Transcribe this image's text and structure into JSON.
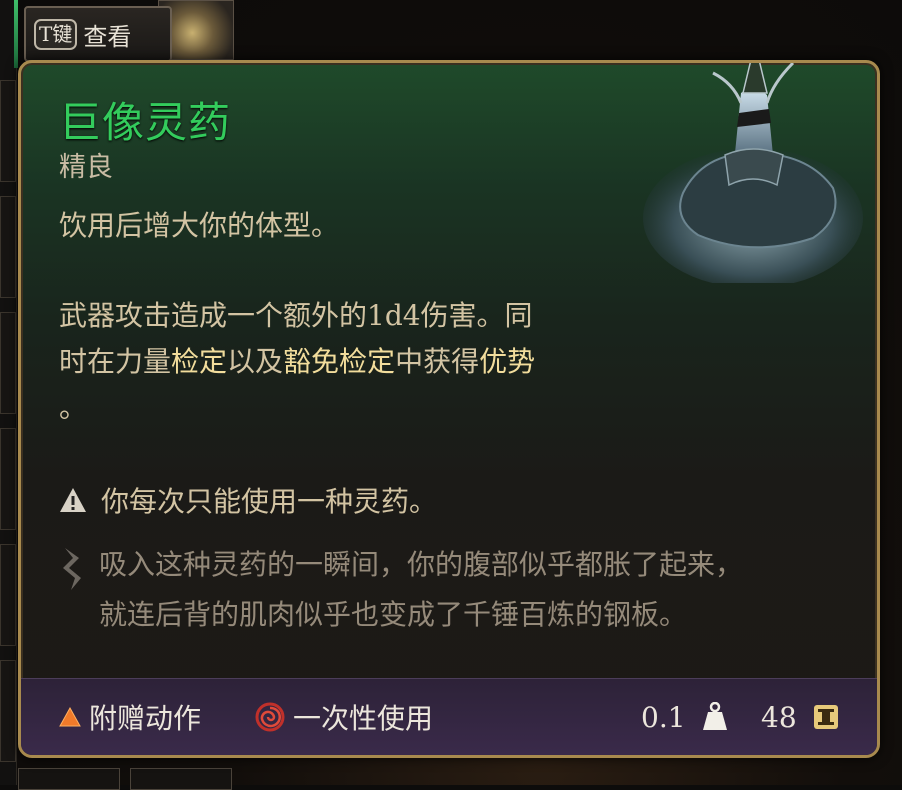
{
  "peek": {
    "key": "T键",
    "label": "查看"
  },
  "item": {
    "name": "巨像灵药",
    "rarity": "精良",
    "description_line": "饮用后增大你的体型。",
    "effect": {
      "part1": "武器攻击造成一个额外的1d4伤害。同",
      "part2a": "时在力量",
      "part2b_hl": "检定",
      "part2c": "以及",
      "part2d_hl": "豁免检定",
      "part2e": "中获得",
      "part2f_hl": "优势",
      "part3": "。"
    },
    "warning": "你每次只能使用一种灵药。",
    "flavor_line1": "吸入这种灵药的一瞬间，你的腹部似乎都胀了起来，",
    "flavor_line2": "就连后背的肌肉似乎也变成了千锤百炼的钢板。"
  },
  "footer": {
    "action": "附赠动作",
    "usage": "一次性使用",
    "weight": "0.1",
    "value": "48"
  },
  "icons": {
    "action": "triangle-icon",
    "usage": "spiral-icon",
    "weight": "weight-icon",
    "value": "coin-icon",
    "warning": "warning-icon",
    "flavor": "feather-icon"
  },
  "colors": {
    "title": "#33cc5c",
    "highlight": "#f2dd9c",
    "frame": "#a88a4e"
  }
}
